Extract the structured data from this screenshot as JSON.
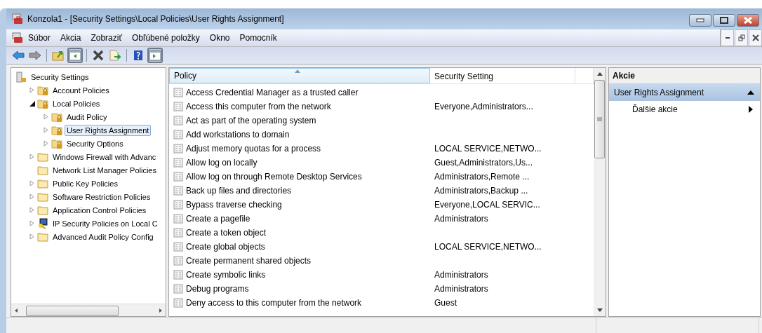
{
  "window": {
    "title": "Konzola1 - [Security Settings\\Local Policies\\User Rights Assignment]"
  },
  "menu": [
    "Súbor",
    "Akcia",
    "Zobraziť",
    "Obľúbené položky",
    "Okno",
    "Pomocník"
  ],
  "toolbar": [
    {
      "kind": "back",
      "pressed": false
    },
    {
      "kind": "forward",
      "pressed": false
    },
    {
      "kind": "up",
      "pressed": false
    },
    {
      "kind": "tree",
      "pressed": true
    },
    {
      "kind": "delete",
      "pressed": false
    },
    {
      "kind": "export",
      "pressed": false
    },
    {
      "kind": "help",
      "pressed": false
    },
    {
      "kind": "actions",
      "pressed": true
    }
  ],
  "tree": [
    {
      "label": "Security Settings",
      "kind": "root",
      "selected": false,
      "children": [
        {
          "label": "Account Policies",
          "kind": "lock-folder",
          "expanded": false,
          "selected": false
        },
        {
          "label": "Local Policies",
          "kind": "lock-folder",
          "expanded": true,
          "selected": false,
          "children": [
            {
              "label": "Audit Policy",
              "kind": "lock-folder",
              "expanded": false,
              "selected": false
            },
            {
              "label": "User Rights Assignment",
              "kind": "lock-folder",
              "expanded": false,
              "selected": true
            },
            {
              "label": "Security Options",
              "kind": "lock-folder",
              "expanded": false,
              "selected": false
            }
          ]
        },
        {
          "label": "Windows Firewall with Advanc",
          "kind": "folder",
          "expanded": false,
          "selected": false
        },
        {
          "label": "Network List Manager Policies",
          "kind": "folder",
          "selected": false
        },
        {
          "label": "Public Key Policies",
          "kind": "folder",
          "expanded": false,
          "selected": false
        },
        {
          "label": "Software Restriction Policies",
          "kind": "folder",
          "expanded": false,
          "selected": false
        },
        {
          "label": "Application Control Policies",
          "kind": "folder",
          "expanded": false,
          "selected": false
        },
        {
          "label": "IP Security Policies on Local C",
          "kind": "computer",
          "expanded": false,
          "selected": false
        },
        {
          "label": "Advanced Audit Policy Config",
          "kind": "folder",
          "expanded": false,
          "selected": false
        }
      ]
    }
  ],
  "table": {
    "columns": [
      {
        "label": "Policy",
        "sorted": true
      },
      {
        "label": "Security Setting",
        "sorted": false
      }
    ],
    "rows": [
      {
        "policy": "Access Credential Manager as a trusted caller",
        "setting": ""
      },
      {
        "policy": "Access this computer from the network",
        "setting": "Everyone,Administrators..."
      },
      {
        "policy": "Act as part of the operating system",
        "setting": ""
      },
      {
        "policy": "Add workstations to domain",
        "setting": ""
      },
      {
        "policy": "Adjust memory quotas for a process",
        "setting": "LOCAL SERVICE,NETWO..."
      },
      {
        "policy": "Allow log on locally",
        "setting": "Guest,Administrators,Us..."
      },
      {
        "policy": "Allow log on through Remote Desktop Services",
        "setting": "Administrators,Remote ..."
      },
      {
        "policy": "Back up files and directories",
        "setting": "Administrators,Backup ..."
      },
      {
        "policy": "Bypass traverse checking",
        "setting": "Everyone,LOCAL SERVIC..."
      },
      {
        "policy": "Create a pagefile",
        "setting": "Administrators"
      },
      {
        "policy": "Create a token object",
        "setting": ""
      },
      {
        "policy": "Create global objects",
        "setting": "LOCAL SERVICE,NETWO..."
      },
      {
        "policy": "Create permanent shared objects",
        "setting": ""
      },
      {
        "policy": "Create symbolic links",
        "setting": "Administrators"
      },
      {
        "policy": "Debug programs",
        "setting": "Administrators"
      },
      {
        "policy": "Deny access to this computer from the network",
        "setting": "Guest"
      }
    ]
  },
  "actions": {
    "title": "Akcie",
    "section": {
      "label": "User Rights Assignment",
      "expanded": true
    },
    "items": [
      {
        "label": "Ďalšie akcie",
        "submenu": true
      }
    ]
  }
}
